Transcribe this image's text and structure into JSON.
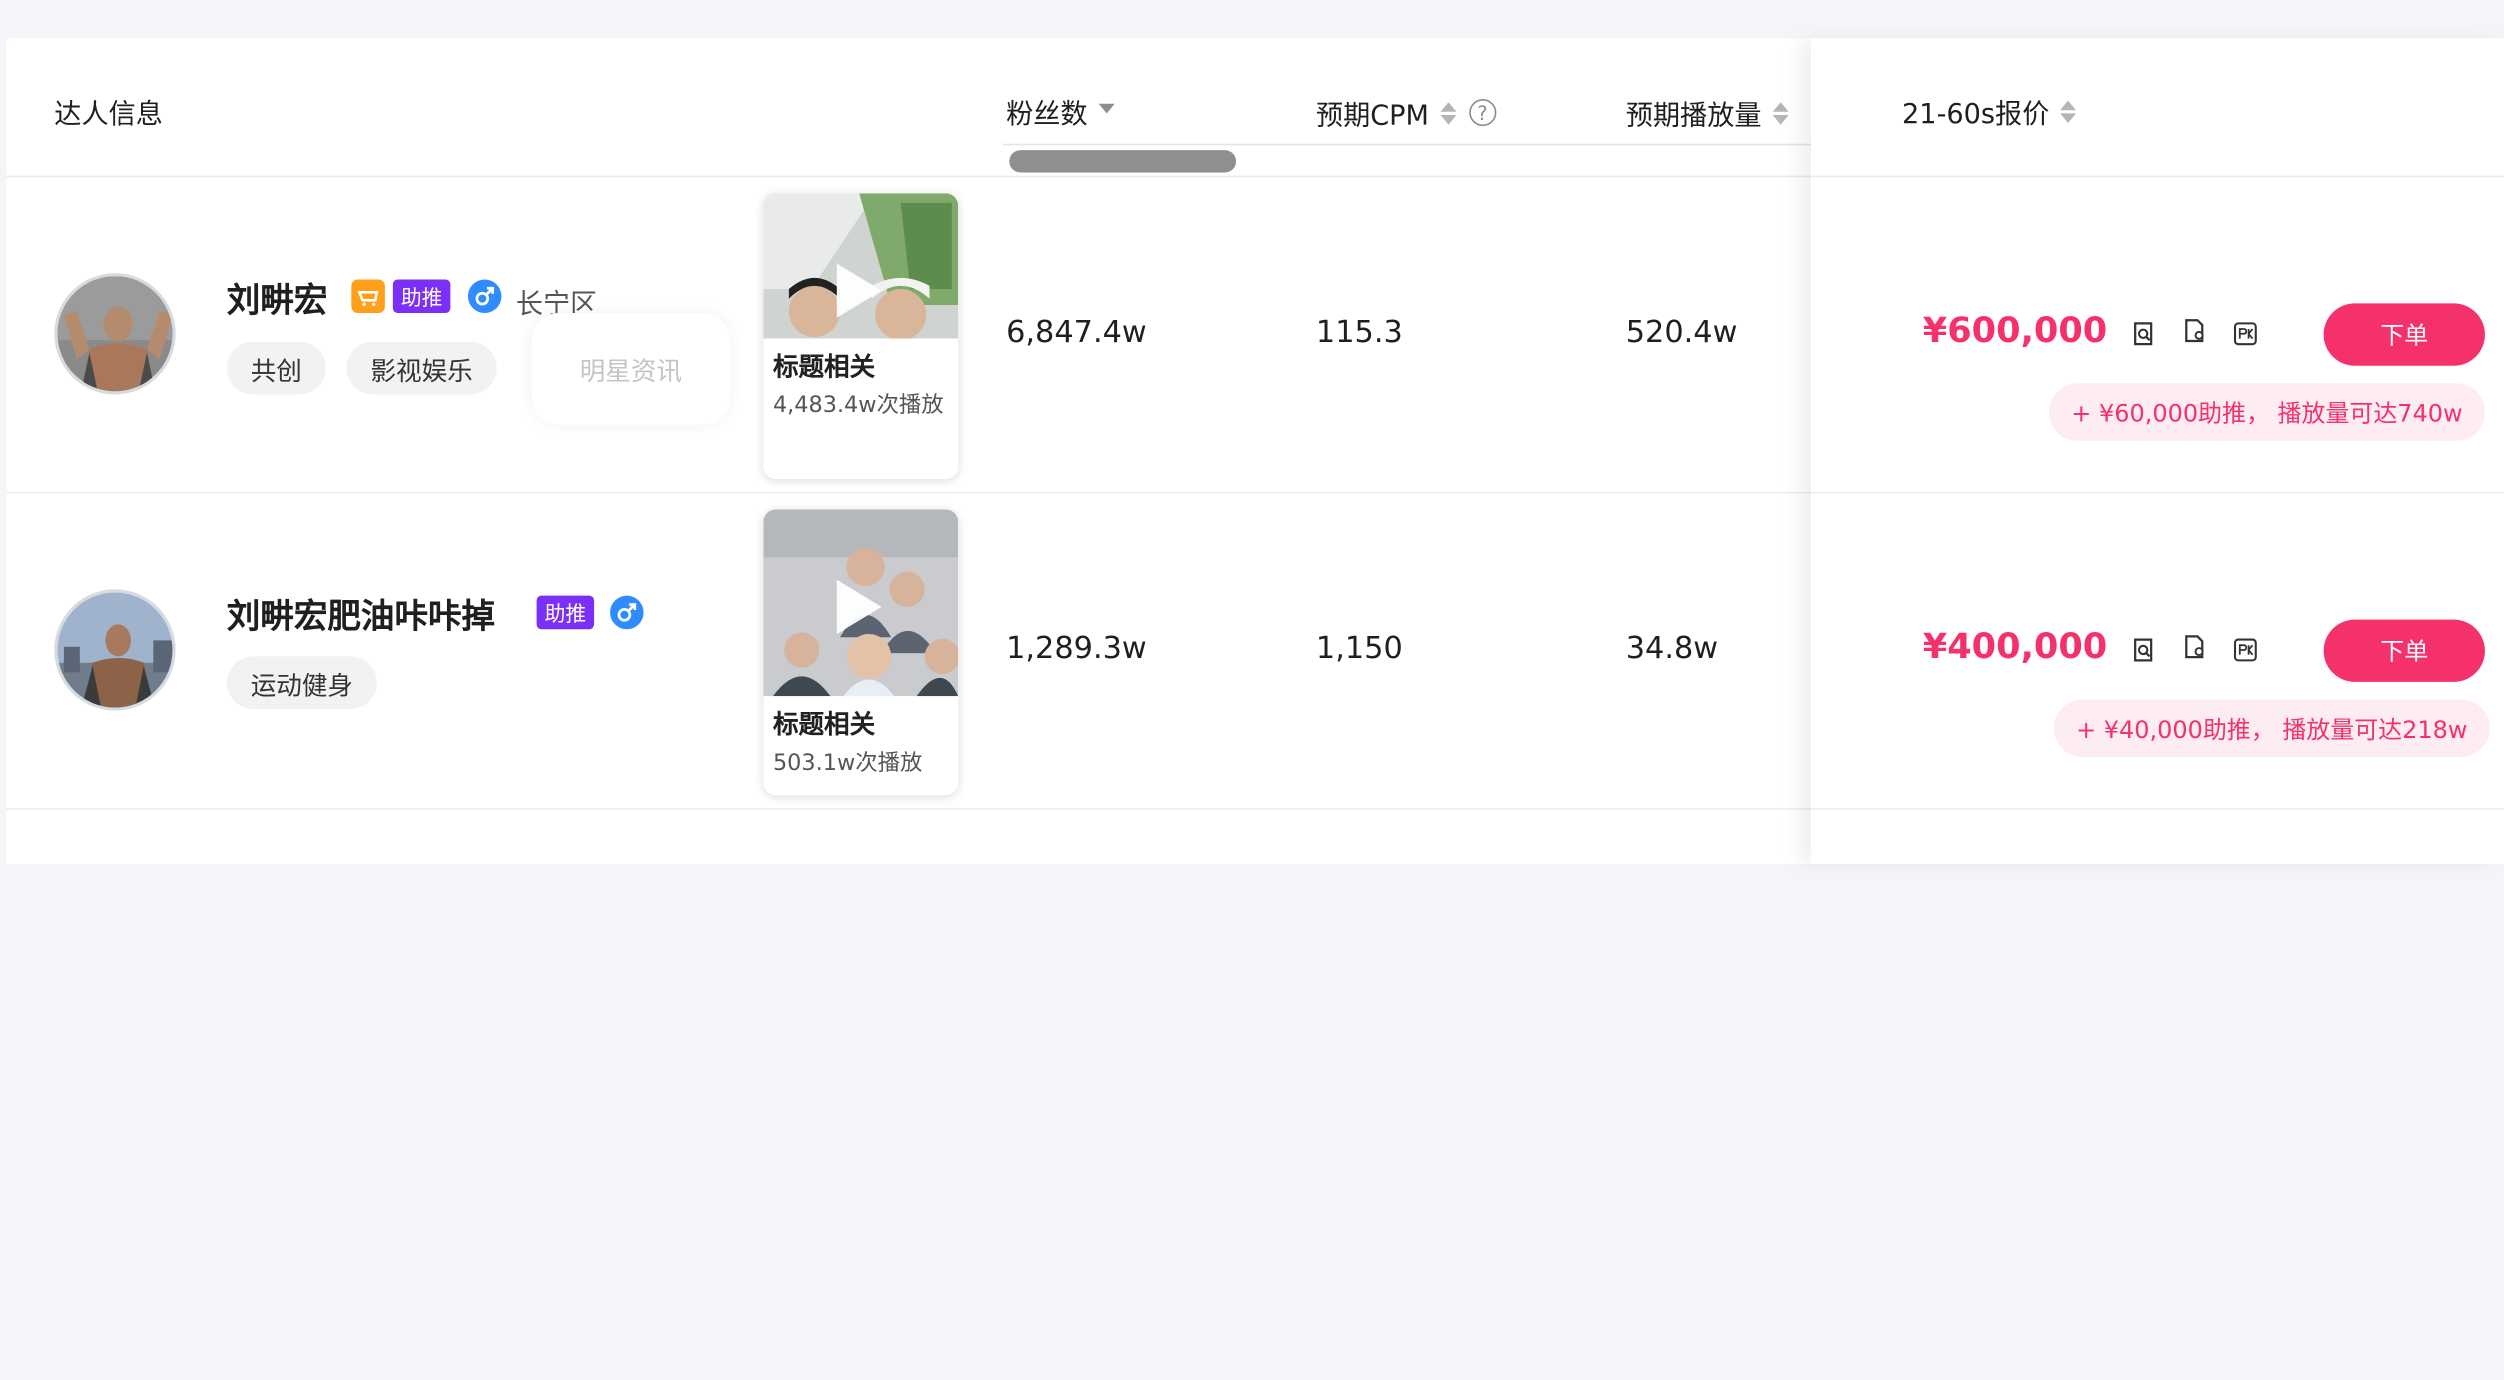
{
  "header": {
    "influencer_info": "达人信息",
    "fans": "粉丝数",
    "cpm": "预期CPM",
    "plays": "预期播放量",
    "price_col": "21-60s报价",
    "help_glyph": "?"
  },
  "rows": [
    {
      "name": "刘畊宏",
      "badge_boost": "助推",
      "region": "长宁区",
      "tags": [
        "共创",
        "影视娱乐",
        "明星资讯"
      ],
      "video_title": "标题相关",
      "video_sub": "4,483.4w次播放",
      "fans": "6,847.4w",
      "cpm": "115.3",
      "plays": "520.4w",
      "price": "¥600,000",
      "order_label": "下单",
      "boost_note": "+ ¥60,000助推， 播放量可达740w"
    },
    {
      "name": "刘畊宏肥油咔咔掉",
      "badge_boost": "助推",
      "tags": [
        "运动健身"
      ],
      "video_title": "标题相关",
      "video_sub": "503.1w次播放",
      "fans": "1,289.3w",
      "cpm": "1,150",
      "plays": "34.8w",
      "price": "¥400,000",
      "order_label": "下单",
      "boost_note": "+ ¥40,000助推， 播放量可达218w"
    }
  ],
  "icons": [
    "shop-icon",
    "male-icon",
    "preview-icon",
    "document-icon",
    "pk-icon",
    "play-icon",
    "help-icon"
  ],
  "colors": {
    "accent": "#f5316b",
    "boost_badge": "#7b2ff7",
    "shop_badge": "#ff9f1a",
    "male_icon": "#2f8cff"
  }
}
